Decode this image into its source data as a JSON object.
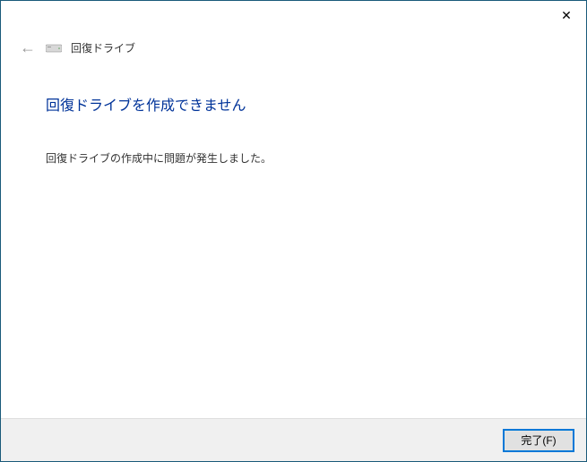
{
  "titlebar": {
    "close_symbol": "✕"
  },
  "header": {
    "back_symbol": "←",
    "wizard_title": "回復ドライブ"
  },
  "content": {
    "heading": "回復ドライブを作成できません",
    "message": "回復ドライブの作成中に問題が発生しました。"
  },
  "footer": {
    "finish_label": "完了(F)"
  }
}
